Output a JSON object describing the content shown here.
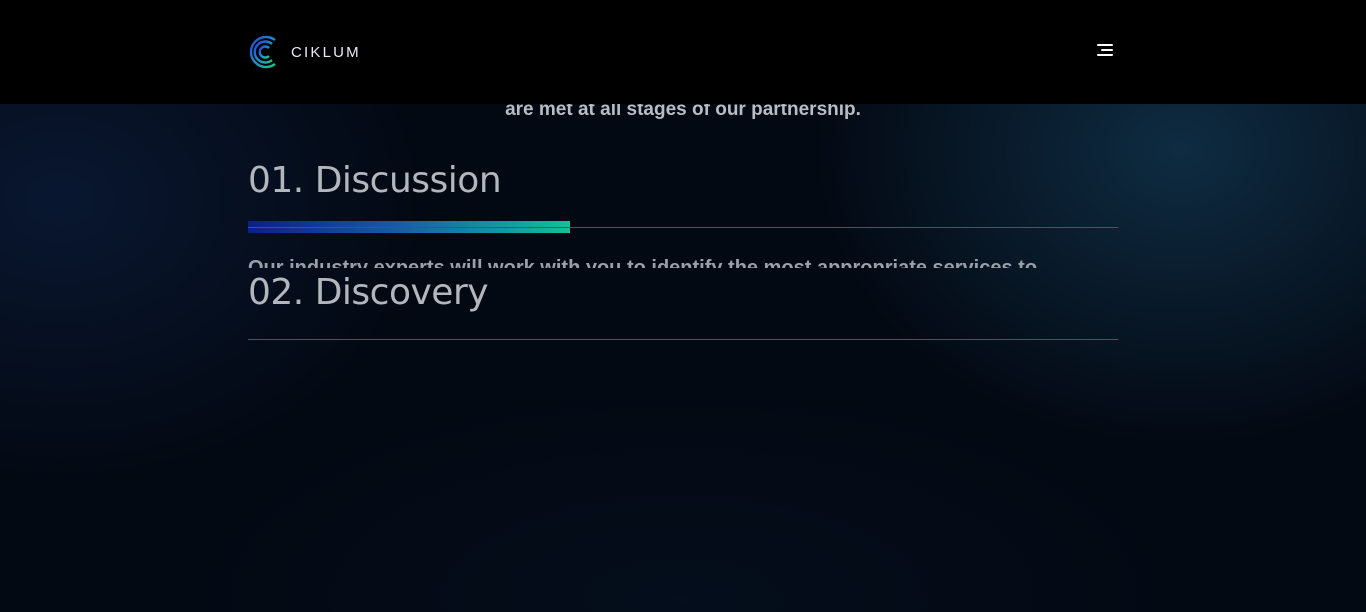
{
  "header": {
    "brand": "CIKLUM",
    "menu_icon": "hamburger-menu-icon"
  },
  "intro": {
    "text": "are met at all stages of our partnership."
  },
  "steps": [
    {
      "title": "01. Discussion",
      "description": "Our industry experts will work with you to identify the most appropriate services to",
      "progress": 0.37
    },
    {
      "title": "02. Discovery"
    }
  ],
  "colors": {
    "header_bg": "#000000",
    "progress_start": "#0b1e8c",
    "progress_end": "#0fc29a",
    "divider": "#1d6b5d"
  }
}
